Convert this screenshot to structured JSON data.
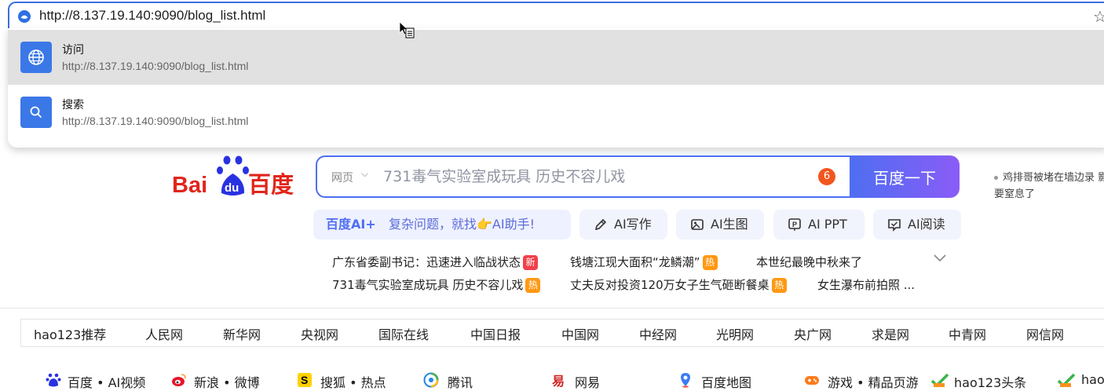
{
  "address_bar": {
    "url": "http://8.137.19.140:9090/blog_list.html"
  },
  "omnibox": {
    "suggestions": [
      {
        "title": "访问",
        "subtitle": "http://8.137.19.140:9090/blog_list.html",
        "icon": "globe-icon"
      },
      {
        "title": "搜索",
        "subtitle": "http://8.137.19.140:9090/blog_list.html",
        "icon": "search-icon"
      }
    ]
  },
  "search": {
    "scope": "网页",
    "placeholder": "731毒气实验室成玩具 历史不容儿戏",
    "badge": "6",
    "button_label": "百度一下"
  },
  "side_news": {
    "text": "鸡排哥被堵在墙边录 影：要窒息了"
  },
  "ai_bar": {
    "brand": "百度AI+",
    "prompt": "复杂问题，就找👉AI助手!",
    "tools": [
      {
        "label": "AI写作",
        "icon": "pen-icon"
      },
      {
        "label": "AI生图",
        "icon": "image-icon"
      },
      {
        "label": "AI PPT",
        "icon": "ppt-icon"
      },
      {
        "label": "AI阅读",
        "icon": "read-icon"
      }
    ]
  },
  "hot_search": [
    {
      "text": "广东省委副书记：迅速进入临战状态",
      "tag": "新"
    },
    {
      "text": "钱塘江现大面积“龙鳞潮”",
      "tag": "热"
    },
    {
      "text": "本世纪最晚中秋来了",
      "tag": ""
    },
    {
      "text": "731毒气实验室成玩具 历史不容儿戏",
      "tag": "热"
    },
    {
      "text": "丈夫反对投资120万女子生气砸断餐桌",
      "tag": "热"
    },
    {
      "text": "女生瀑布前拍照 ...",
      "tag": ""
    }
  ],
  "site_nav": [
    "hao123推荐",
    "人民网",
    "新华网",
    "央视网",
    "国际在线",
    "中国日报",
    "中国网",
    "中经网",
    "光明网",
    "央广网",
    "求是网",
    "中青网",
    "网信网"
  ],
  "favorites": [
    {
      "label": "百度 • AI视频",
      "icon": "baidu-paw-icon"
    },
    {
      "label": "新浪 • 微博",
      "icon": "weibo-icon"
    },
    {
      "label": "搜狐 • 热点",
      "icon": "sohu-icon"
    },
    {
      "label": "腾讯",
      "icon": "qq-icon"
    },
    {
      "label": "网易",
      "icon": "netease-icon"
    },
    {
      "label": "百度地图",
      "icon": "map-pin-icon"
    },
    {
      "label": "游戏 • 精品页游",
      "icon": "gamepad-icon"
    },
    {
      "label": "hao123头条",
      "icon": "hao123-icon"
    },
    {
      "label": "hao",
      "icon": "hao123-icon"
    }
  ],
  "colors": {
    "accent": "#4e6ef2",
    "brand_red": "#e1251b",
    "new_tag": "#f1404b",
    "hot_tag": "#ff9812"
  }
}
